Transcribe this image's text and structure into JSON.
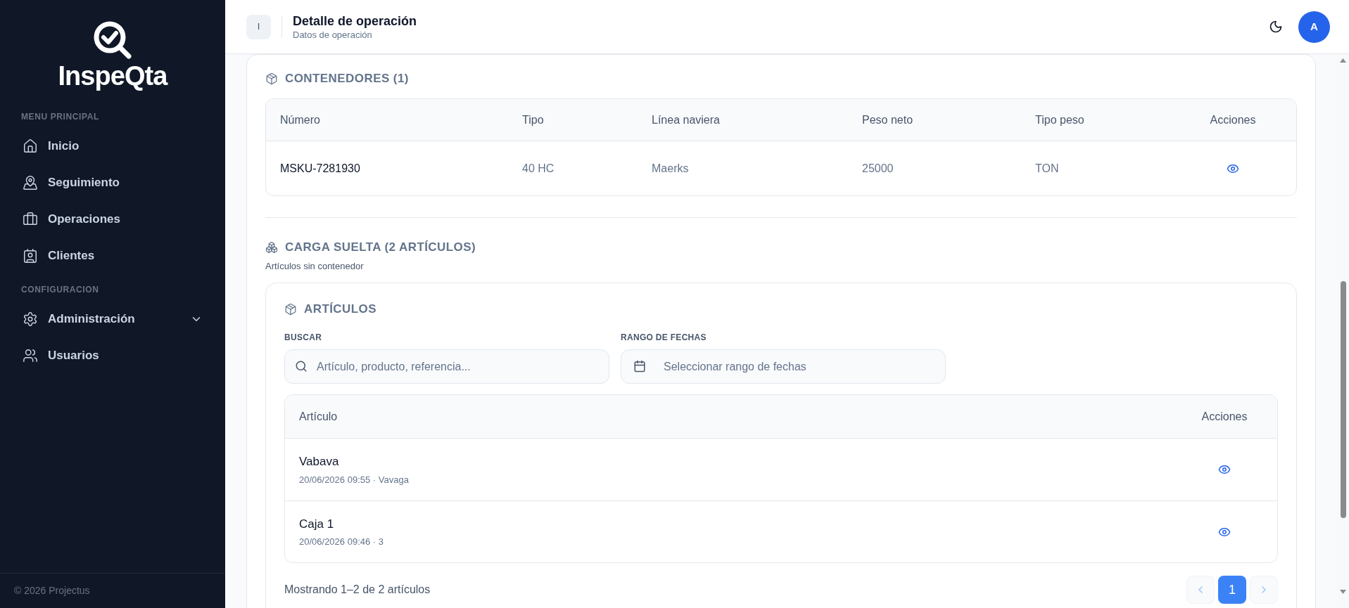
{
  "sidebar": {
    "logo_text": "InspeQta",
    "sections": [
      {
        "title": "MENU PRINCIPAL",
        "items": [
          {
            "label": "Inicio",
            "kind": "link"
          },
          {
            "label": "Seguimiento",
            "kind": "link"
          },
          {
            "label": "Operaciones",
            "kind": "link"
          },
          {
            "label": "Clientes",
            "kind": "link"
          }
        ]
      },
      {
        "title": "CONFIGURACION",
        "items": [
          {
            "label": "Administración",
            "kind": "group",
            "expanded": false
          },
          {
            "label": "Usuarios",
            "kind": "link"
          }
        ]
      }
    ],
    "footer": "© 2026 Projectus"
  },
  "header": {
    "badge": "I",
    "title": "Detalle de operación",
    "subtitle": "Datos de operación",
    "avatar": "A"
  },
  "containers": {
    "title": "CONTENEDORES (1)",
    "columns": [
      "Número",
      "Tipo",
      "Línea naviera",
      "Peso neto",
      "Tipo peso",
      "Acciones"
    ],
    "rows": [
      [
        "MSKU-7281930",
        "40 HC",
        "Maerks",
        "25000",
        "TON"
      ]
    ]
  },
  "loose_cargo": {
    "title": "CARGA SUELTA (2 ARTÍCULOS)",
    "subtitle": "Artículos sin contenedor",
    "articles": {
      "title": "ARTÍCULOS",
      "search": {
        "label": "BUSCAR",
        "placeholder": "Artículo, producto, referencia..."
      },
      "date_range": {
        "label": "RANGO DE FECHAS",
        "placeholder": "Seleccionar rango de fechas"
      },
      "columns": [
        "Artículo",
        "Acciones"
      ],
      "rows": [
        {
          "name": "Vabava",
          "meta": "20/06/2026 09:55 · Vavaga"
        },
        {
          "name": "Caja 1",
          "meta": "20/06/2026 09:46 · 3"
        }
      ],
      "summary": "Mostrando 1–2 de 2 artículos",
      "pagination": {
        "previous": {
          "disabled": true
        },
        "pages": [
          {
            "label": "1",
            "selected": true
          }
        ],
        "next": {
          "disabled": true
        }
      }
    }
  }
}
